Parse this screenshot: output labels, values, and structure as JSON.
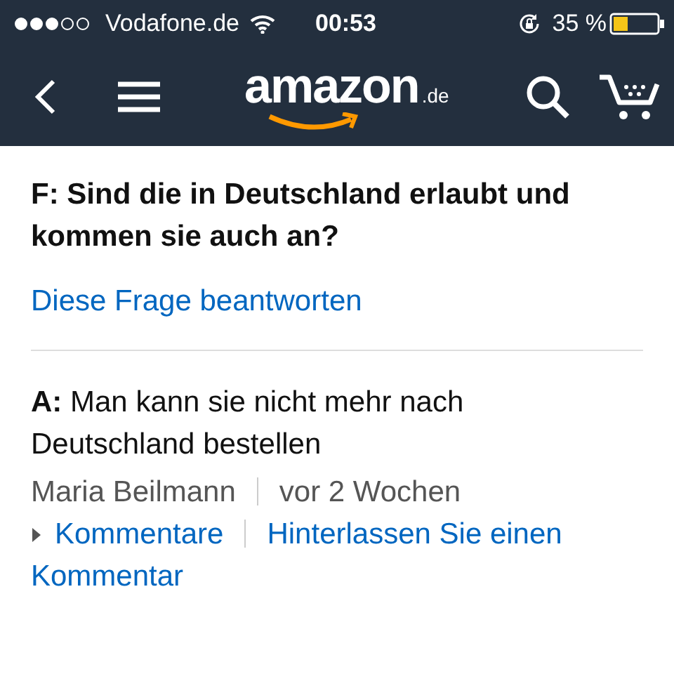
{
  "status_bar": {
    "carrier": "Vodafone.de",
    "time": "00:53",
    "battery_percent": "35 %"
  },
  "nav_bar": {
    "logo": {
      "name": "amazon",
      "domain": ".de"
    }
  },
  "question": {
    "text": "F: Sind die in Deutschland erlaubt und kommen sie auch an?",
    "answer_link": "Diese Frage beantworten"
  },
  "answer": {
    "text": "**A:** Man kann sie nicht mehr nach Deutschland bestellen",
    "author": "Maria Beilmann",
    "date": "vor 2 Wochen",
    "comments_link": "Kommentare",
    "comments_expanded": false,
    "leave_comment_link": "Hinterlassen Sie einen Kommentar"
  }
}
